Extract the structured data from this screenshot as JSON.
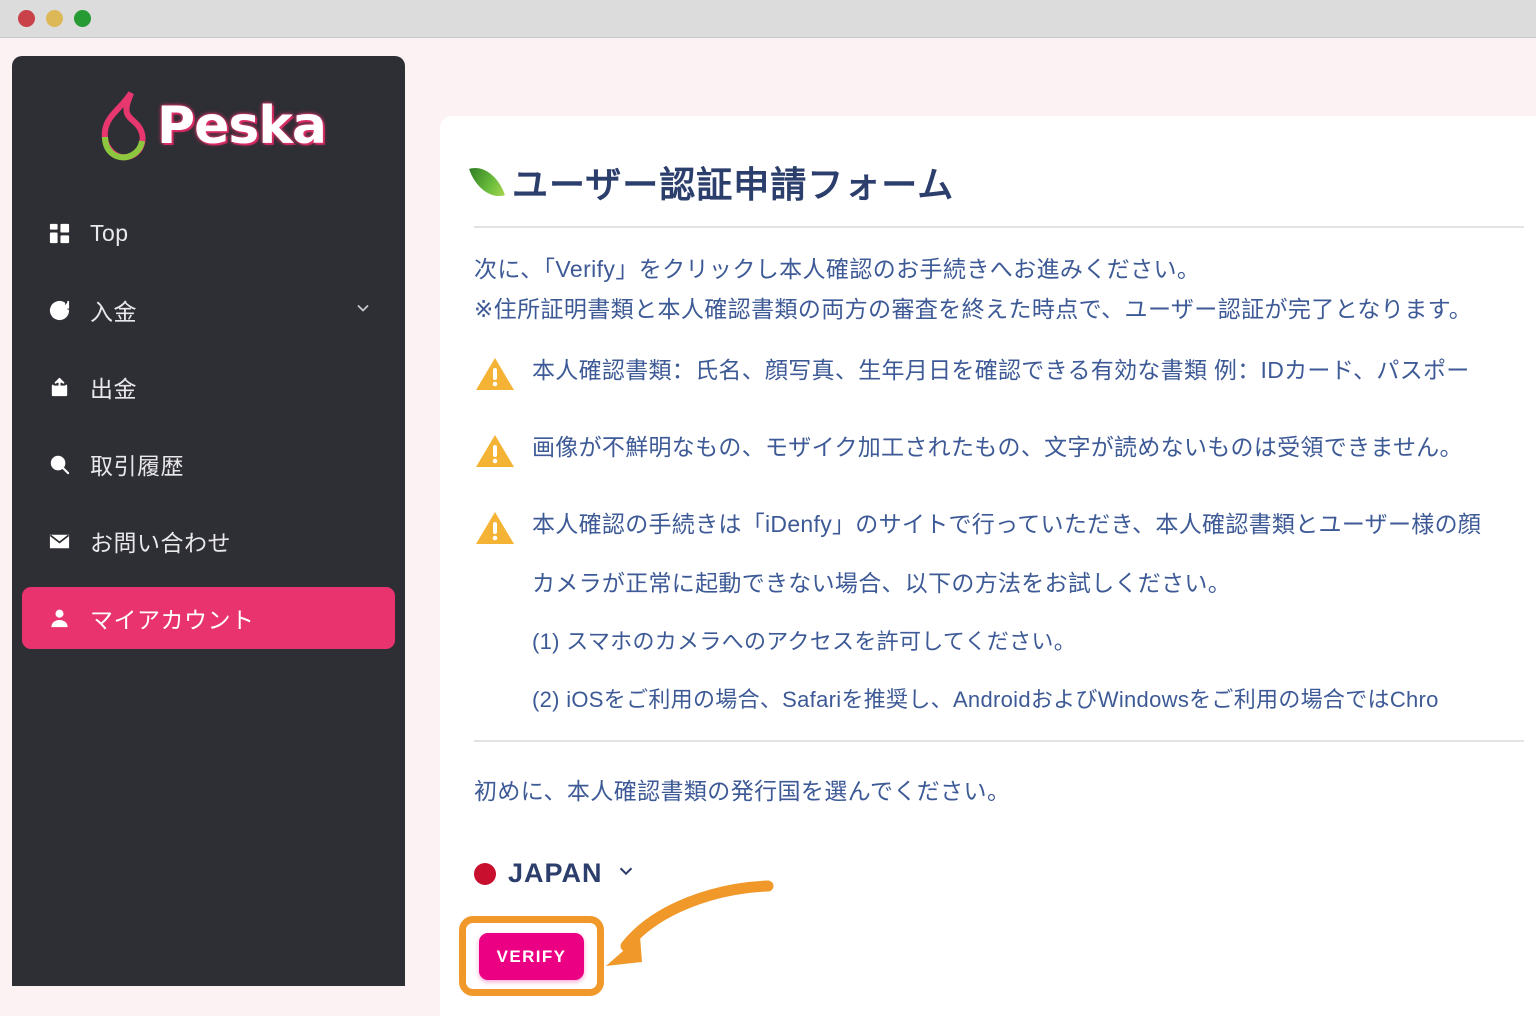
{
  "window": {
    "traffic_lights": [
      "close",
      "minimize",
      "maximize"
    ]
  },
  "sidebar": {
    "logo_text": "Peska",
    "items": [
      {
        "label": "Top",
        "icon": "grid-icon",
        "active": false,
        "expandable": false
      },
      {
        "label": "入金",
        "icon": "deposit-icon",
        "active": false,
        "expandable": true
      },
      {
        "label": "出金",
        "icon": "withdraw-icon",
        "active": false,
        "expandable": false
      },
      {
        "label": "取引履歴",
        "icon": "search-icon",
        "active": false,
        "expandable": false
      },
      {
        "label": "お問い合わせ",
        "icon": "mail-icon",
        "active": false,
        "expandable": false
      },
      {
        "label": "マイアカウント",
        "icon": "user-icon",
        "active": true,
        "expandable": false
      }
    ]
  },
  "main": {
    "title": "ユーザー認証申請フォーム",
    "intro_line1": "次に、「Verify」をクリックし本人確認のお手続きへお進みください。",
    "intro_line2": "※住所証明書類と本人確認書類の両方の審査を終えた時点で、ユーザー認証が完了となります。",
    "warnings": [
      "本人確認書類：氏名、顔写真、生年月日を確認できる有効な書類 例：IDカード、パスポー",
      "画像が不鮮明なもの、モザイク加工されたもの、文字が読めないものは受領できません。",
      "本人確認の手続きは「iDenfy」のサイトで行っていただき、本人確認書類とユーザー様の顔"
    ],
    "camera_note": "カメラが正常に起動できない場合、以下の方法をお試しください。",
    "steps": [
      "(1) スマホのカメラへのアクセスを許可してください。",
      "(2) iOSをご利用の場合、Safariを推奨し、AndroidおよびWindowsをご利用の場合ではChro"
    ],
    "country_prompt": "初めに、本人確認書類の発行国を選んでください。",
    "country_selected": "JAPAN",
    "verify_button": "VERIFY"
  },
  "colors": {
    "accent_pink": "#e8336e",
    "verify_magenta": "#ec0083",
    "highlight_orange": "#f0992a",
    "sidebar_bg": "#2e2e35",
    "page_bg": "#fdf2f3",
    "text_navy": "#3d5a96",
    "warning_amber": "#f5b335"
  }
}
